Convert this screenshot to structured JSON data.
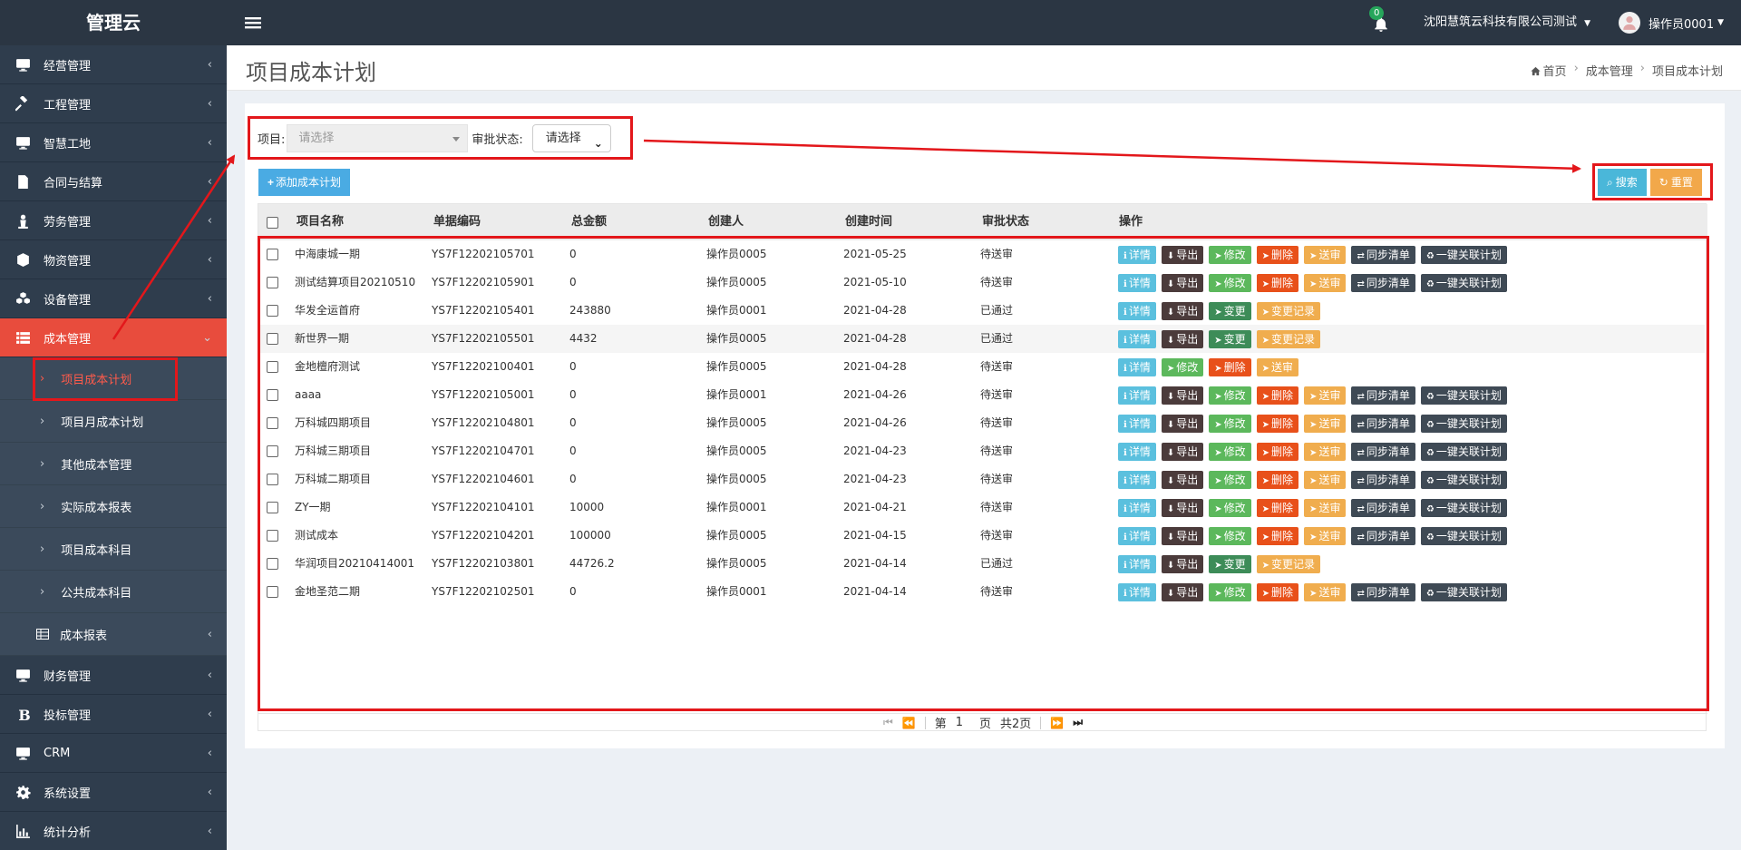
{
  "app": {
    "logo": "管理云"
  },
  "sidebar": {
    "items": [
      {
        "label": "经营管理",
        "icon": "monitor-icon"
      },
      {
        "label": "工程管理",
        "icon": "gavel-icon"
      },
      {
        "label": "智慧工地",
        "icon": "monitor-icon"
      },
      {
        "label": "合同与结算",
        "icon": "file-icon"
      },
      {
        "label": "劳务管理",
        "icon": "worker-icon"
      },
      {
        "label": "物资管理",
        "icon": "cube-icon"
      },
      {
        "label": "设备管理",
        "icon": "cubes-icon"
      },
      {
        "label": "成本管理",
        "icon": "list-icon",
        "active": true
      }
    ],
    "sub_items": [
      "项目成本计划",
      "项目月成本计划",
      "其他成本管理",
      "实际成本报表",
      "项目成本科目",
      "公共成本科目"
    ],
    "report_item": "成本报表",
    "bottom_items": [
      {
        "label": "财务管理",
        "icon": "monitor-icon"
      },
      {
        "label": "投标管理",
        "icon": "bold-b-icon"
      },
      {
        "label": "CRM",
        "icon": "monitor-icon"
      },
      {
        "label": "系统设置",
        "icon": "gear-icon"
      },
      {
        "label": "统计分析",
        "icon": "chart-icon"
      }
    ]
  },
  "topbar": {
    "notification_count": "0",
    "company": "沈阳慧筑云科技有限公司测试",
    "user": "操作员0001"
  },
  "page": {
    "title": "项目成本计划",
    "breadcrumb": [
      "首页",
      "成本管理",
      "项目成本计划"
    ]
  },
  "filters": {
    "project_label": "项目:",
    "project_placeholder": "请选择",
    "status_label": "审批状态:",
    "status_value": "请选择"
  },
  "toolbar": {
    "add_label": "添加成本计划",
    "search_label": "搜索",
    "reset_label": "重置"
  },
  "table": {
    "headers": [
      "项目名称",
      "单据编码",
      "总金额",
      "创建人",
      "创建时间",
      "审批状态",
      "操作"
    ],
    "rows": [
      {
        "name": "中海康城一期",
        "code": "YS7F12202105701",
        "amount": "0",
        "creator": "操作员0005",
        "date": "2021-05-25",
        "status": "待送审"
      },
      {
        "name": "测试结算项目20210510",
        "code": "YS7F12202105901",
        "amount": "0",
        "creator": "操作员0005",
        "date": "2021-05-10",
        "status": "待送审"
      },
      {
        "name": "华发全运首府",
        "code": "YS7F12202105401",
        "amount": "243880",
        "creator": "操作员0001",
        "date": "2021-04-28",
        "status": "已通过"
      },
      {
        "name": "新世界一期",
        "code": "YS7F12202105501",
        "amount": "4432",
        "creator": "操作员0005",
        "date": "2021-04-28",
        "status": "已通过"
      },
      {
        "name": "金地檀府测试",
        "code": "YS7F12202100401",
        "amount": "0",
        "creator": "操作员0005",
        "date": "2021-04-28",
        "status": "待送审"
      },
      {
        "name": "aaaa",
        "code": "YS7F12202105001",
        "amount": "0",
        "creator": "操作员0001",
        "date": "2021-04-26",
        "status": "待送审"
      },
      {
        "name": "万科城四期项目",
        "code": "YS7F12202104801",
        "amount": "0",
        "creator": "操作员0005",
        "date": "2021-04-26",
        "status": "待送审"
      },
      {
        "name": "万科城三期项目",
        "code": "YS7F12202104701",
        "amount": "0",
        "creator": "操作员0005",
        "date": "2021-04-23",
        "status": "待送审"
      },
      {
        "name": "万科城二期项目",
        "code": "YS7F12202104601",
        "amount": "0",
        "creator": "操作员0005",
        "date": "2021-04-23",
        "status": "待送审"
      },
      {
        "name": "ZY一期",
        "code": "YS7F12202104101",
        "amount": "10000",
        "creator": "操作员0001",
        "date": "2021-04-21",
        "status": "待送审"
      },
      {
        "name": "测试成本",
        "code": "YS7F12202104201",
        "amount": "100000",
        "creator": "操作员0005",
        "date": "2021-04-15",
        "status": "待送审"
      },
      {
        "name": "华润项目20210414001",
        "code": "YS7F12202103801",
        "amount": "44726.2",
        "creator": "操作员0005",
        "date": "2021-04-14",
        "status": "已通过"
      },
      {
        "name": "金地圣范二期",
        "code": "YS7F12202102501",
        "amount": "0",
        "creator": "操作员0001",
        "date": "2021-04-14",
        "status": "待送审"
      }
    ],
    "action_sets": {
      "full": [
        "详情",
        "导出",
        "修改",
        "删除",
        "送审",
        "同步清单",
        "一键关联计划"
      ],
      "approved": [
        "详情",
        "导出",
        "变更",
        "变更记录"
      ],
      "short": [
        "详情",
        "修改",
        "删除",
        "送审"
      ]
    },
    "row_action_set": [
      "full",
      "full",
      "approved",
      "approved",
      "short",
      "full",
      "full",
      "full",
      "full",
      "full",
      "full",
      "approved",
      "full"
    ]
  },
  "pager": {
    "page_prefix": "第",
    "current_page": "1",
    "page_suffix": "页",
    "total": "共2页"
  },
  "colors": {
    "sidebar_bg": "#2b3643",
    "active_red": "#e84c3d",
    "annotation_red": "#e3171b"
  }
}
